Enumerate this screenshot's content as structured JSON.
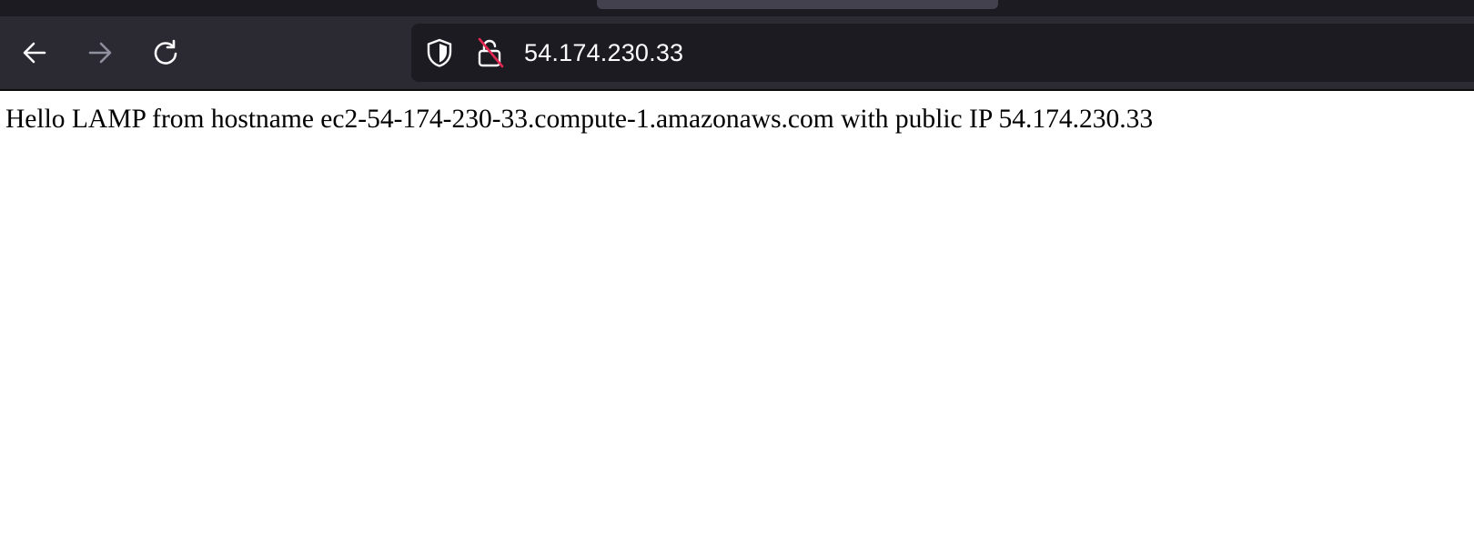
{
  "browser": {
    "toolbar": {
      "icons": {
        "back": "back-arrow-icon",
        "forward": "forward-arrow-icon",
        "reload": "reload-icon",
        "shield": "shield-icon",
        "lock": "insecure-lock-icon"
      },
      "forward_enabled": false
    },
    "urlbar": {
      "value": "54.174.230.33"
    },
    "colors": {
      "toolbar_bg": "#2b2a33",
      "urlbar_bg": "#1c1b22",
      "icon": "#fbfbfe",
      "disabled_icon": "#8f8f9d",
      "insecure_strike": "#e22850"
    }
  },
  "page": {
    "text": "Hello LAMP from hostname ec2-54-174-230-33.compute-1.amazonaws.com with public IP 54.174.230.33"
  }
}
